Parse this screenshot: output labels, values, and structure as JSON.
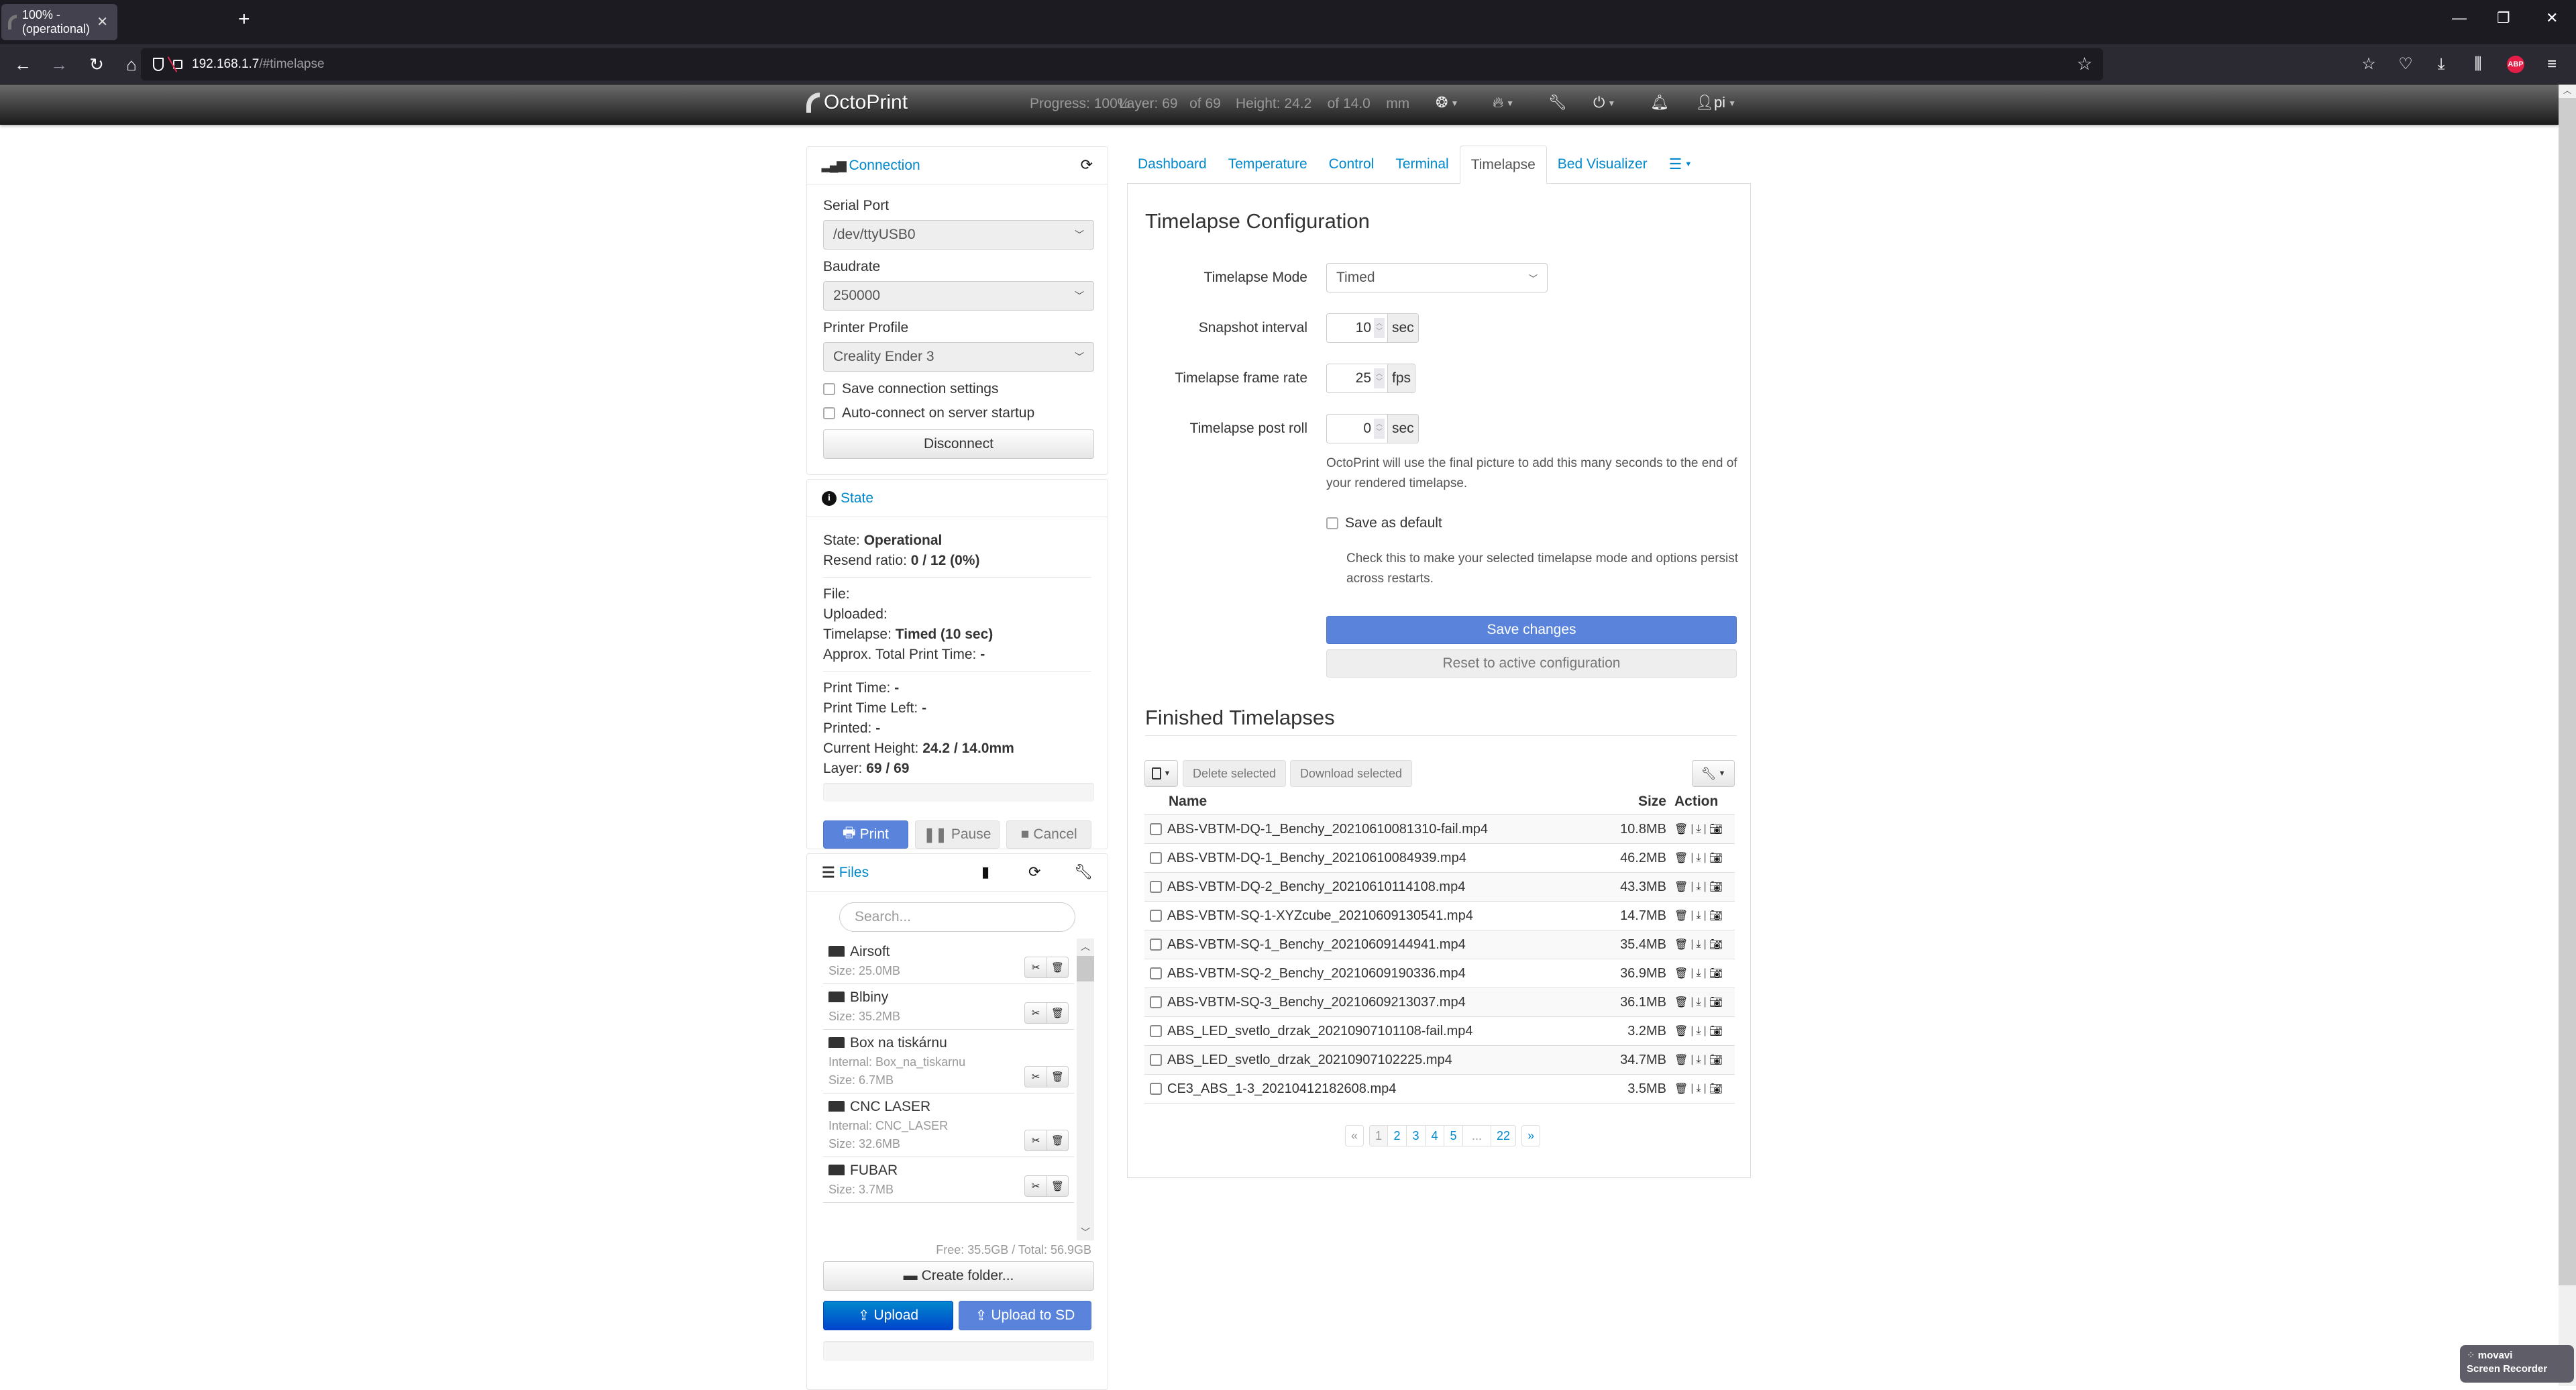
{
  "browser": {
    "tab_title": "100% - (operational)",
    "url_host": "192.168.1.7",
    "url_path": "/#timelapse"
  },
  "navbar": {
    "brand": "OctoPrint",
    "progress_label": "Progress:",
    "progress_value": "100%",
    "layer_label": "Layer:",
    "layer_value": "69",
    "layer_of": "of 69",
    "height_label": "Height:",
    "height_value": "24.2",
    "height_of": "of 14.0",
    "height_unit": "mm",
    "user": "pi"
  },
  "connection": {
    "title": "Connection",
    "serial_port_label": "Serial Port",
    "serial_port_value": "/dev/ttyUSB0",
    "baudrate_label": "Baudrate",
    "baudrate_value": "250000",
    "profile_label": "Printer Profile",
    "profile_value": "Creality Ender 3",
    "save_settings_label": "Save connection settings",
    "autoconnect_label": "Auto-connect on server startup",
    "disconnect_label": "Disconnect"
  },
  "state": {
    "title": "State",
    "rows_a": [
      {
        "label": "State: ",
        "value": "Operational"
      },
      {
        "label": "Resend ratio: ",
        "value": "0 / 12 (0%)"
      }
    ],
    "rows_b": [
      {
        "label": "File:",
        "value": ""
      },
      {
        "label": "Uploaded:",
        "value": ""
      },
      {
        "label": "Timelapse: ",
        "value": "Timed (10 sec)"
      },
      {
        "label": "Approx. Total Print Time: ",
        "value": "-"
      }
    ],
    "rows_c": [
      {
        "label": "Print Time: ",
        "value": "-"
      },
      {
        "label": "Print Time Left: ",
        "value": "-"
      },
      {
        "label": "Printed: ",
        "value": "-"
      },
      {
        "label": "Current Height: ",
        "value": "24.2 / 14.0mm"
      },
      {
        "label": "Layer: ",
        "value": "69 / 69"
      }
    ],
    "print_label": "Print",
    "pause_label": "Pause",
    "cancel_label": "Cancel"
  },
  "files": {
    "title": "Files",
    "search_placeholder": "Search...",
    "entries": [
      {
        "name": "Airsoft",
        "internal": "",
        "size": "Size: 25.0MB"
      },
      {
        "name": "Blbiny",
        "internal": "",
        "size": "Size: 35.2MB"
      },
      {
        "name": "Box na tiskárnu",
        "internal": "Internal: Box_na_tiskarnu",
        "size": "Size: 6.7MB"
      },
      {
        "name": "CNC LASER",
        "internal": "Internal: CNC_LASER",
        "size": "Size: 32.6MB"
      },
      {
        "name": "FUBAR",
        "internal": "",
        "size": "Size: 3.7MB"
      }
    ],
    "free_total": "Free: 35.5GB / Total: 56.9GB",
    "create_folder_label": "Create folder...",
    "upload_label": "Upload",
    "upload_sd_label": "Upload to SD"
  },
  "tabs": [
    {
      "label": "Dashboard",
      "active": false
    },
    {
      "label": "Temperature",
      "active": false
    },
    {
      "label": "Control",
      "active": false
    },
    {
      "label": "Terminal",
      "active": false
    },
    {
      "label": "Timelapse",
      "active": true
    },
    {
      "label": "Bed Visualizer",
      "active": false
    }
  ],
  "timelapse_config": {
    "heading": "Timelapse Configuration",
    "mode_label": "Timelapse Mode",
    "mode_value": "Timed",
    "interval_label": "Snapshot interval",
    "interval_value": "10",
    "interval_unit": "sec",
    "framerate_label": "Timelapse frame rate",
    "framerate_value": "25",
    "framerate_unit": "fps",
    "postroll_label": "Timelapse post roll",
    "postroll_value": "0",
    "postroll_unit": "sec",
    "postroll_help": "OctoPrint will use the final picture to add this many seconds to the end of your rendered timelapse.",
    "save_default_label": "Save as default",
    "save_default_help": "Check this to make your selected timelapse mode and options persist across restarts.",
    "save_changes_label": "Save changes",
    "reset_label": "Reset to active configuration"
  },
  "finished": {
    "heading": "Finished Timelapses",
    "delete_selected_label": "Delete selected",
    "download_selected_label": "Download selected",
    "columns": {
      "name": "Name",
      "size": "Size",
      "action": "Action"
    },
    "rows": [
      {
        "name": "ABS-VBTM-DQ-1_Benchy_20210610081310-fail.mp4",
        "size": "10.8MB"
      },
      {
        "name": "ABS-VBTM-DQ-1_Benchy_20210610084939.mp4",
        "size": "46.2MB"
      },
      {
        "name": "ABS-VBTM-DQ-2_Benchy_20210610114108.mp4",
        "size": "43.3MB"
      },
      {
        "name": "ABS-VBTM-SQ-1-XYZcube_20210609130541.mp4",
        "size": "14.7MB"
      },
      {
        "name": "ABS-VBTM-SQ-1_Benchy_20210609144941.mp4",
        "size": "35.4MB"
      },
      {
        "name": "ABS-VBTM-SQ-2_Benchy_20210609190336.mp4",
        "size": "36.9MB"
      },
      {
        "name": "ABS-VBTM-SQ-3_Benchy_20210609213037.mp4",
        "size": "36.1MB"
      },
      {
        "name": "ABS_LED_svetlo_drzak_20210907101108-fail.mp4",
        "size": "3.2MB"
      },
      {
        "name": "ABS_LED_svetlo_drzak_20210907102225.mp4",
        "size": "34.7MB"
      },
      {
        "name": "CE3_ABS_1-3_20210412182608.mp4",
        "size": "3.5MB"
      }
    ],
    "pagination": {
      "prev": "«",
      "pages": [
        "1",
        "2",
        "3",
        "4",
        "5",
        "...",
        "22"
      ],
      "current": "1",
      "next": "»"
    }
  },
  "watermark": {
    "line1": "movavi",
    "line2": "Screen Recorder"
  }
}
